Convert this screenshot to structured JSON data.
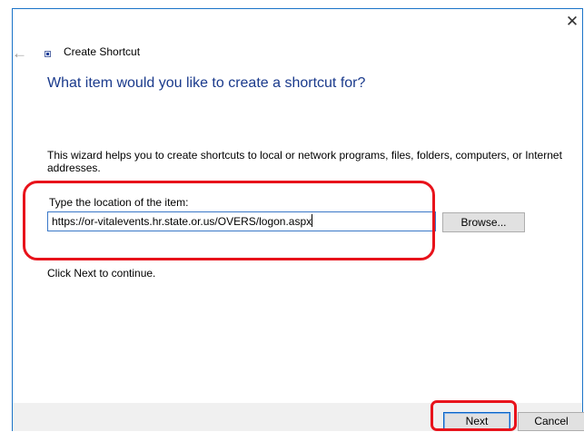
{
  "dialog": {
    "title": "Create Shortcut",
    "close_glyph": "✕",
    "back_glyph": "←",
    "heading": "What item would you like to create a shortcut for?",
    "description": "This wizard helps you to create shortcuts to local or network programs, files, folders, computers, or Internet addresses.",
    "location_label": "Type the location of the item:",
    "location_value": "https://or-vitalevents.hr.state.or.us/OVERS/logon.aspx",
    "browse_label": "Browse...",
    "hint": "Click Next to continue."
  },
  "footer": {
    "next_label": "Next",
    "cancel_label": "Cancel"
  },
  "colors": {
    "heading": "#1a3a8c",
    "window_border": "#1a73c8",
    "highlight": "#e8131b",
    "footer_bg": "#f0f0f0"
  },
  "icons": [
    "close-icon",
    "back-arrow-icon",
    "shortcut-wizard-icon"
  ]
}
